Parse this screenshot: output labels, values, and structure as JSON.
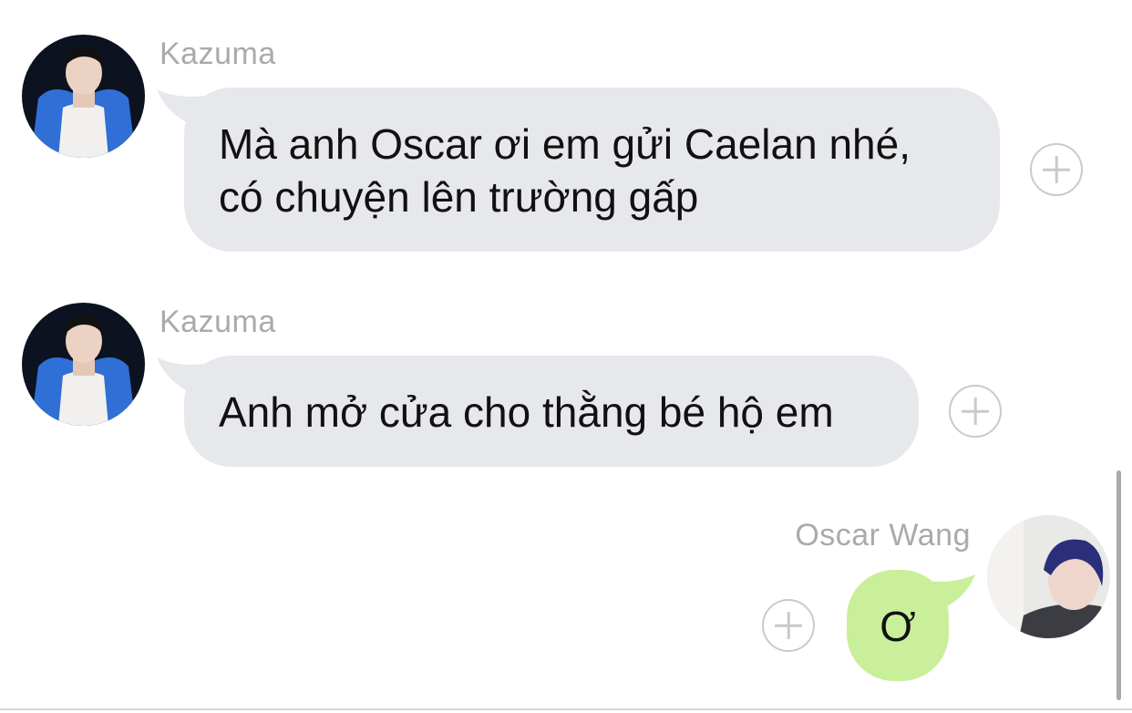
{
  "messages": [
    {
      "sender": "Kazuma",
      "lines": [
        "Mà anh Oscar ơi em gửi Caelan nhé,",
        "có chuyện lên trường gấp"
      ]
    },
    {
      "sender": "Kazuma",
      "lines": [
        "Anh mở cửa cho thằng bé hộ em"
      ]
    },
    {
      "sender": "Oscar Wang",
      "lines": [
        "Ơ"
      ]
    }
  ],
  "colors": {
    "incoming_bubble": "#e6e8eb",
    "outgoing_bubble": "#c9ef9b",
    "sender_name": "#a9aaad",
    "plus_icon": "#c9cacd"
  },
  "icons": [
    "plus-circle-icon",
    "avatar-photo"
  ]
}
